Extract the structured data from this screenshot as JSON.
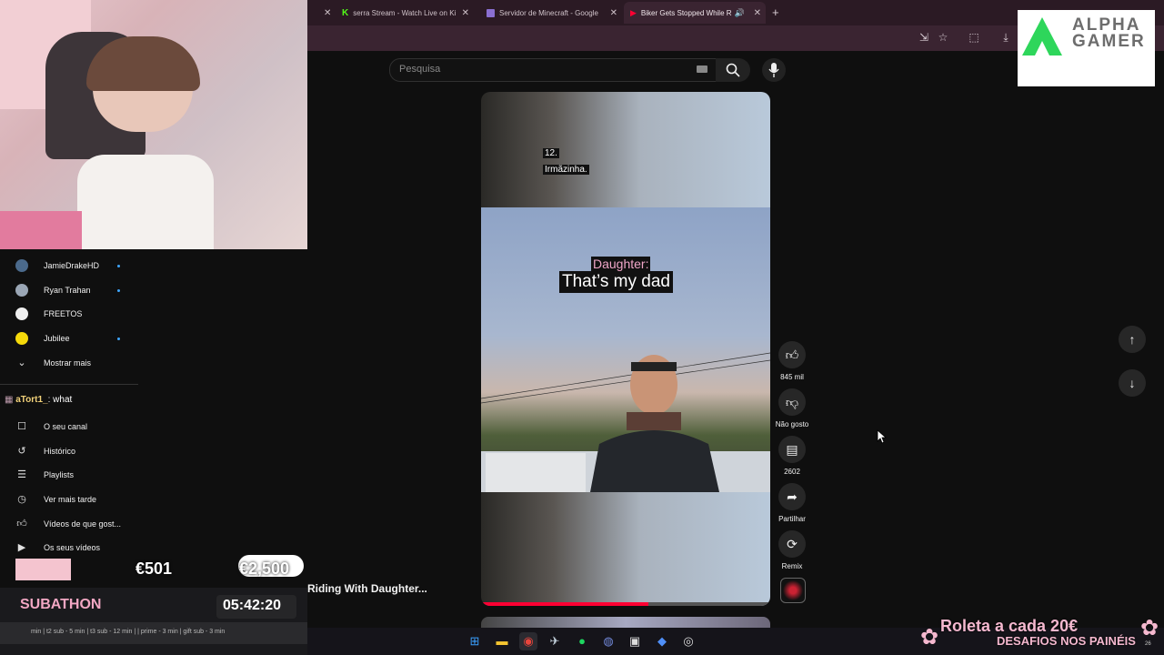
{
  "browser": {
    "tabs": [
      {
        "label": "serra Stream - Watch Live on Ki"
      },
      {
        "label": "Servidor de Minecraft - Google"
      },
      {
        "label": "Biker Gets Stopped While R"
      }
    ],
    "new_tab": "+"
  },
  "youtube": {
    "search_placeholder": "Pesquisa",
    "sidebar": {
      "subscriptions": [
        {
          "name": "JamieDrakeHD"
        },
        {
          "name": "Ryan Trahan"
        },
        {
          "name": "FREETOS"
        },
        {
          "name": "Jubilee"
        }
      ],
      "show_more": "Mostrar mais",
      "you_items": [
        {
          "label": "O seu canal"
        },
        {
          "label": "Histórico"
        },
        {
          "label": "Playlists"
        },
        {
          "label": "Ver mais tarde"
        },
        {
          "label": "Vídeos de que gost..."
        },
        {
          "label": "Os seus vídeos"
        }
      ]
    },
    "short": {
      "caption_top_num": "12.",
      "caption_top_text": "Irmãzinha.",
      "caption_speaker": "Daughter:",
      "caption_line": "That’s my dad",
      "partial_title": "Riding With Daughter...",
      "progress": 0.58
    },
    "actions": {
      "likes": "845 mil",
      "dislike": "Não gosto",
      "comments": "2602",
      "share": "Partilhar",
      "remix": "Remix"
    }
  },
  "overlay": {
    "brand_line1": "ALPHA",
    "brand_line2": "GAMER",
    "chat_user": "aTort1_",
    "chat_message": ": what",
    "goal_current": "€501",
    "goal_target": "€2,500",
    "subathon_label": "SUBATHON",
    "subathon_timer": "05:42:20",
    "subathon_rules": "min | t2 sub - 5 min | t3 sub - 12 min | | prime - 3 min | gift sub - 3 min",
    "roulette": "Roleta a cada 20€",
    "challenges": "DESAFIOS NOS PAINÉIS",
    "corner_num": "26"
  },
  "colors": {
    "accent_red": "#ff0033",
    "pink": "#f0a6c8",
    "subathon_pink": "#f2a7c3"
  }
}
